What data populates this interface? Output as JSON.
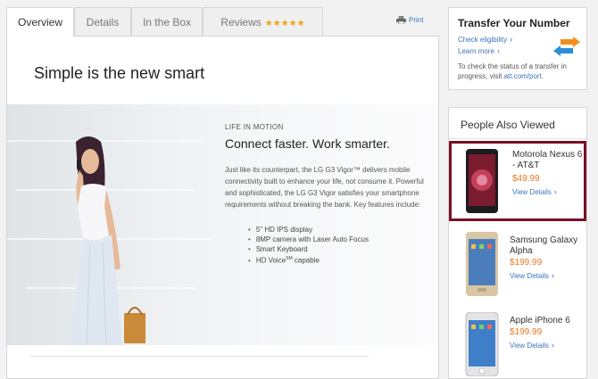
{
  "tabs": [
    {
      "label": "Overview",
      "active": true
    },
    {
      "label": "Details"
    },
    {
      "label": "In the Box"
    },
    {
      "label": "Reviews",
      "stars": "★★★★★"
    }
  ],
  "print_label": "Print",
  "headline": "Simple is the new smart",
  "hero": {
    "eyebrow": "LIFE IN MOTION",
    "title": "Connect faster. Work smarter.",
    "body": "Just like its counterpart, the LG G3 Vigor™ delivers mobile connectivity built to enhance your life, not consume it. Powerful and sophisticated, the LG G3 Vigor satisfies your smartphone requirements without breaking the bank. Key features include:",
    "features": [
      "5\" HD IPS display",
      "8MP camera with Laser Auto Focus",
      "Smart Keyboard",
      "HD Voice",
      "capable"
    ],
    "feature_superscript": "SM"
  },
  "transfer": {
    "title": "Transfer Your Number",
    "check_eligibility": "Check eligibility",
    "learn_more": "Learn more",
    "note_prefix": "To check the status of a transfer in progress, visit ",
    "note_link": "att.com/port",
    "note_suffix": ".",
    "accent_colors": {
      "blue": "#2c8fd6",
      "orange": "#f0901e"
    }
  },
  "people_also_viewed": {
    "title": "People Also Viewed",
    "products": [
      {
        "name": "Motorola Nexus 6 - AT&T",
        "price": "$49.99",
        "details": "View Details",
        "highlighted": true
      },
      {
        "name": "Samsung Galaxy Alpha",
        "price": "$199.99",
        "details": "View Details"
      },
      {
        "name": "Apple iPhone 6",
        "price": "$199.99",
        "details": "View Details"
      }
    ]
  },
  "colors": {
    "link": "#3b73b9",
    "price": "#e87722",
    "highlight_border": "#7a1026",
    "stars": "#f0a30a"
  }
}
